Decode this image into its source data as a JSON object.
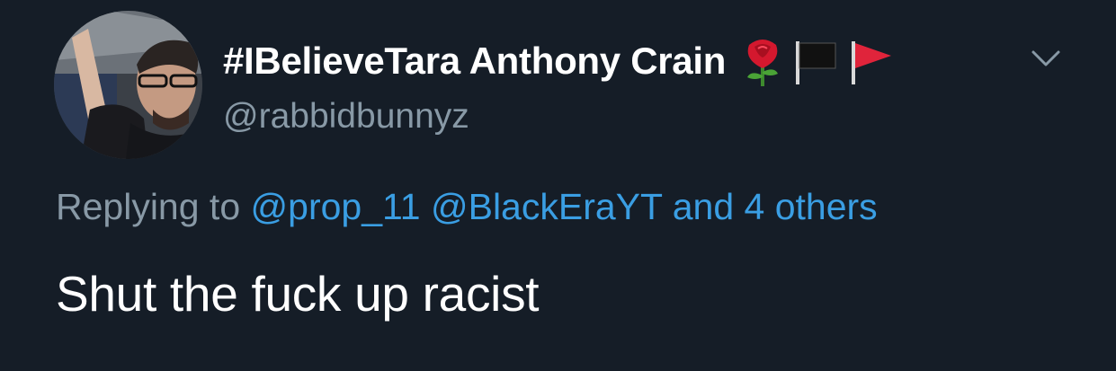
{
  "tweet": {
    "display_name": "#IBelieveTara Anthony Crain",
    "name_emojis": [
      "rose-icon",
      "black-flag-icon",
      "red-flag-icon"
    ],
    "handle": "@rabbidbunnyz",
    "reply": {
      "prefix": "Replying to",
      "mention_1": "@prop_11",
      "mention_2": "@BlackEraYT",
      "suffix": "and 4 others"
    },
    "text": "Shut the fuck up racist"
  },
  "colors": {
    "background": "#151d27",
    "primary_text": "#ffffff",
    "secondary_text": "#8899a6",
    "link": "#3a9ee3"
  }
}
